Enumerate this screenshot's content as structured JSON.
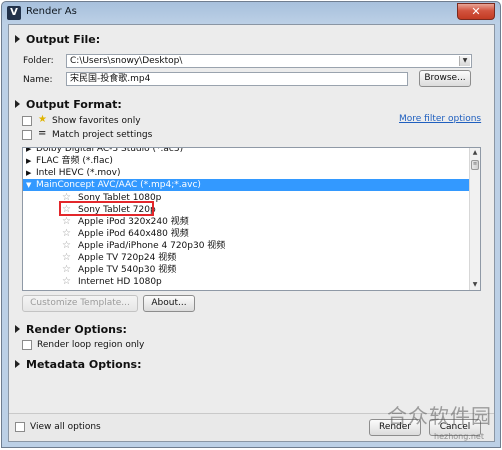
{
  "window": {
    "title": "Render As",
    "app_icon_glyph": "V",
    "close_glyph": "✕"
  },
  "output_file": {
    "heading": "Output File:",
    "folder_label": "Folder:",
    "folder_value": "C:\\Users\\snowy\\Desktop\\",
    "name_label": "Name:",
    "name_value": "宋民国-投食歌.mp4",
    "browse_label": "Browse..."
  },
  "output_format": {
    "heading": "Output Format:",
    "show_favorites_label": "Show favorites only",
    "match_project_label": "Match project settings",
    "more_filter_link": "More filter options",
    "formats": [
      {
        "label": "Dolby Digital AC-3 Studio (*.ac3)",
        "expanded": false
      },
      {
        "label": "FLAC 音频 (*.flac)",
        "expanded": false
      },
      {
        "label": "Intel HEVC (*.mov)",
        "expanded": false
      },
      {
        "label": "MainConcept AVC/AAC (*.mp4;*.avc)",
        "expanded": true,
        "selected": true
      }
    ],
    "templates": [
      "Sony Tablet 1080p",
      "Sony Tablet 720p",
      "Apple iPod 320x240 视频",
      "Apple iPod 640x480 视频",
      "Apple iPad/iPhone 4 720p30 视频",
      "Apple TV 720p24 视频",
      "Apple TV 540p30 视频",
      "Internet HD 1080p"
    ],
    "highlighted_template": "Sony Tablet 720p",
    "customize_label": "Customize Template...",
    "about_label": "About..."
  },
  "render_options": {
    "heading": "Render Options:",
    "loop_region_label": "Render loop region only"
  },
  "metadata_options": {
    "heading": "Metadata Options:"
  },
  "footer": {
    "view_all_label": "View all options",
    "render_label": "Render",
    "cancel_label": "Cancel"
  },
  "watermark": {
    "text": "合众软件园",
    "url": "hezhong.net"
  },
  "icons": {
    "star": "star-icon",
    "equals": "equals-icon",
    "expand": "triangle-right-icon",
    "collapse": "triangle-down-icon"
  },
  "colors": {
    "selection": "#3399ff",
    "highlight_border": "#e3272b",
    "link": "#1f5fbf",
    "favorite_star": "#e0b400"
  }
}
